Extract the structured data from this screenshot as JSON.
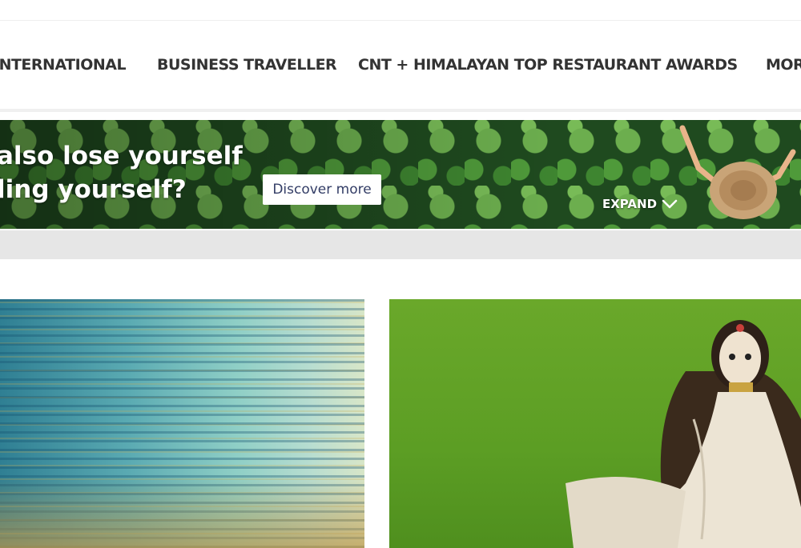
{
  "nav": {
    "items": [
      "INTERNATIONAL",
      "BUSINESS TRAVELLER",
      "CNT + HIMALAYAN TOP RESTAURANT AWARDS",
      "MORE"
    ]
  },
  "banner": {
    "headline_line1": "also lose yourself",
    "headline_line2": "ling yourself?",
    "button_label": "Discover more",
    "expand_label": "EXPAND",
    "colors": {
      "leaf_green": "#4f9a3a",
      "button_text": "#333d66"
    }
  },
  "icons": {
    "expand": "chevron-down-icon"
  }
}
